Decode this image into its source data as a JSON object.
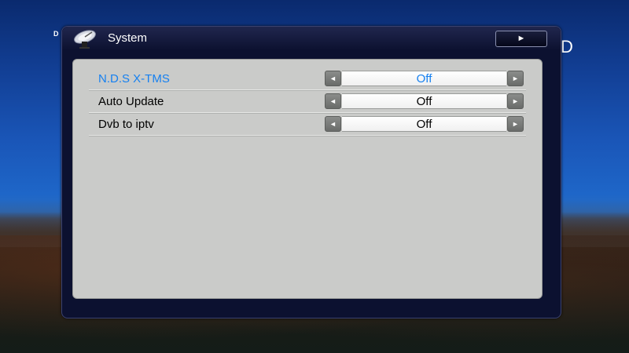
{
  "background": {
    "left_text": "D",
    "right_text": "D"
  },
  "dialog": {
    "title": "System",
    "title_icon": "satellite-dish-icon",
    "play_button_glyph": "►"
  },
  "settings": [
    {
      "label": "N.D.S X-TMS",
      "value": "Off",
      "selected": true
    },
    {
      "label": "Auto Update",
      "value": "Off",
      "selected": false
    },
    {
      "label": "Dvb to iptv",
      "value": "Off",
      "selected": false
    }
  ],
  "arrows": {
    "left": "◄",
    "right": "►"
  },
  "colors": {
    "selected_text": "#1680f0",
    "panel": "#cacbc9",
    "dialog_bg": "#0c1130"
  }
}
